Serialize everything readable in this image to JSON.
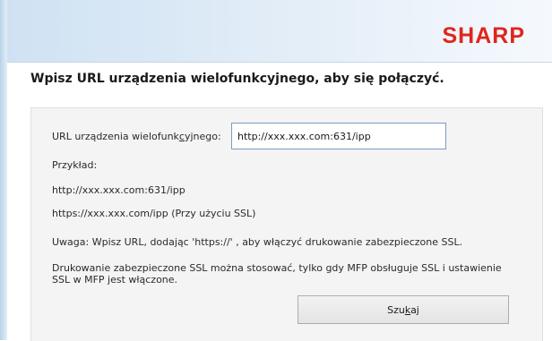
{
  "brand": {
    "logo_text": "SHARP",
    "color": "#e1251b"
  },
  "instruction": "Wpisz URL urządzenia wielofunkcyjnego, aby się połączyć.",
  "form": {
    "url_label_pre": "URL urządzenia wielofunk",
    "url_label_accel": "c",
    "url_label_post": "yjnego:",
    "url_value": "http://xxx.xxx.com:631/ipp"
  },
  "examples": {
    "heading": "Przykład:",
    "http_example": "http://xxx.xxx.com:631/ipp",
    "https_example": "https://xxx.xxx.com/ipp (Przy użyciu SSL)"
  },
  "notes": {
    "warning": "Uwaga: Wpisz URL, dodając 'https://' , aby włączyć drukowanie zabezpieczone SSL.",
    "ssl_info": "Drukowanie zabezpieczone SSL można stosować, tylko gdy MFP obsługuje SSL i ustawienie SSL w MFP jest włączone."
  },
  "buttons": {
    "search_pre": "Szu",
    "search_accel": "k",
    "search_post": "aj"
  }
}
